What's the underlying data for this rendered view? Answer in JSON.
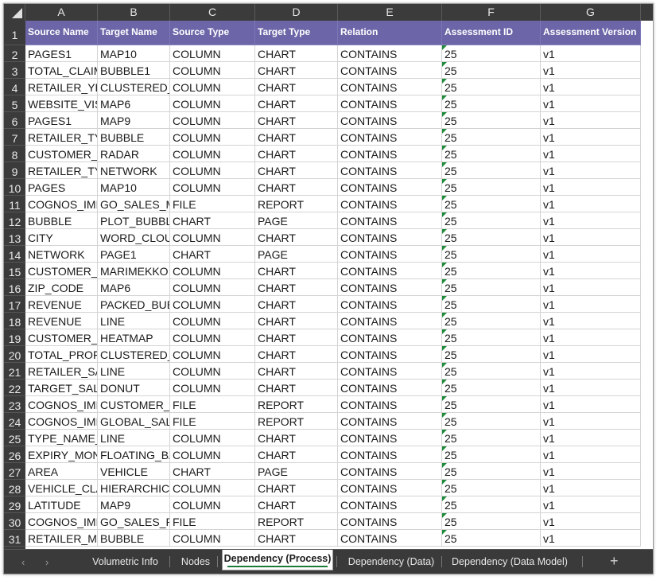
{
  "columns": [
    "A",
    "B",
    "C",
    "D",
    "E",
    "F",
    "G"
  ],
  "header_row": {
    "row_number": "1",
    "cells": [
      "Source Name",
      "Target Name",
      "Source Type",
      "Target Type",
      "Relation",
      "Assessment ID",
      "Assessment Version"
    ]
  },
  "rows": [
    {
      "n": "2",
      "cells": [
        "PAGES1",
        "MAP10",
        "COLUMN",
        "CHART",
        "CONTAINS",
        "25",
        "v1"
      ]
    },
    {
      "n": "3",
      "cells": [
        "TOTAL_CLAIM_",
        "BUBBLE1",
        "COLUMN",
        "CHART",
        "CONTAINS",
        "25",
        "v1"
      ]
    },
    {
      "n": "4",
      "cells": [
        "RETAILER_YEA",
        "CLUSTERED_C",
        "COLUMN",
        "CHART",
        "CONTAINS",
        "25",
        "v1"
      ]
    },
    {
      "n": "5",
      "cells": [
        "WEBSITE_VISI",
        "MAP6",
        "COLUMN",
        "CHART",
        "CONTAINS",
        "25",
        "v1"
      ]
    },
    {
      "n": "6",
      "cells": [
        "PAGES1",
        "MAP9",
        "COLUMN",
        "CHART",
        "CONTAINS",
        "25",
        "v1"
      ]
    },
    {
      "n": "7",
      "cells": [
        "RETAILER_TYPI",
        "BUBBLE",
        "COLUMN",
        "CHART",
        "CONTAINS",
        "25",
        "v1"
      ]
    },
    {
      "n": "8",
      "cells": [
        "CUSTOMER_LI",
        "RADAR",
        "COLUMN",
        "CHART",
        "CONTAINS",
        "25",
        "v1"
      ]
    },
    {
      "n": "9",
      "cells": [
        "RETAILER_TYPI",
        "NETWORK",
        "COLUMN",
        "CHART",
        "CONTAINS",
        "25",
        "v1"
      ]
    },
    {
      "n": "10",
      "cells": [
        "PAGES",
        "MAP10",
        "COLUMN",
        "CHART",
        "CONTAINS",
        "25",
        "v1"
      ]
    },
    {
      "n": "11",
      "cells": [
        "COGNOS_IMP.",
        "GO_SALES_MA",
        "FILE",
        "REPORT",
        "CONTAINS",
        "25",
        "v1"
      ]
    },
    {
      "n": "12",
      "cells": [
        "BUBBLE",
        "PLOT_BUBBLE",
        "CHART",
        "PAGE",
        "CONTAINS",
        "25",
        "v1"
      ]
    },
    {
      "n": "13",
      "cells": [
        "CITY",
        "WORD_CLOUI",
        "COLUMN",
        "CHART",
        "CONTAINS",
        "25",
        "v1"
      ]
    },
    {
      "n": "14",
      "cells": [
        "NETWORK",
        "PAGE1",
        "CHART",
        "PAGE",
        "CONTAINS",
        "25",
        "v1"
      ]
    },
    {
      "n": "15",
      "cells": [
        "CUSTOMER_LI",
        "MARIMEKKO",
        "COLUMN",
        "CHART",
        "CONTAINS",
        "25",
        "v1"
      ]
    },
    {
      "n": "16",
      "cells": [
        "ZIP_CODE",
        "MAP6",
        "COLUMN",
        "CHART",
        "CONTAINS",
        "25",
        "v1"
      ]
    },
    {
      "n": "17",
      "cells": [
        "REVENUE",
        "PACKED_BUBI",
        "COLUMN",
        "CHART",
        "CONTAINS",
        "25",
        "v1"
      ]
    },
    {
      "n": "18",
      "cells": [
        "REVENUE",
        "LINE",
        "COLUMN",
        "CHART",
        "CONTAINS",
        "25",
        "v1"
      ]
    },
    {
      "n": "19",
      "cells": [
        "CUSTOMER_LI",
        "HEATMAP",
        "COLUMN",
        "CHART",
        "CONTAINS",
        "25",
        "v1"
      ]
    },
    {
      "n": "20",
      "cells": [
        "TOTAL_PROFIT",
        "CLUSTERED_E",
        "COLUMN",
        "CHART",
        "CONTAINS",
        "25",
        "v1"
      ]
    },
    {
      "n": "21",
      "cells": [
        "RETAILER_SAL",
        "LINE",
        "COLUMN",
        "CHART",
        "CONTAINS",
        "25",
        "v1"
      ]
    },
    {
      "n": "22",
      "cells": [
        "TARGET_SALES",
        "DONUT",
        "COLUMN",
        "CHART",
        "CONTAINS",
        "25",
        "v1"
      ]
    },
    {
      "n": "23",
      "cells": [
        "COGNOS_IMP.",
        "CUSTOMER_LI",
        "FILE",
        "REPORT",
        "CONTAINS",
        "25",
        "v1"
      ]
    },
    {
      "n": "24",
      "cells": [
        "COGNOS_IMP.",
        "GLOBAL_SALE",
        "FILE",
        "REPORT",
        "CONTAINS",
        "25",
        "v1"
      ]
    },
    {
      "n": "25",
      "cells": [
        "TYPE_NAME_E",
        "LINE",
        "COLUMN",
        "CHART",
        "CONTAINS",
        "25",
        "v1"
      ]
    },
    {
      "n": "26",
      "cells": [
        "EXPIRY_MONT",
        "FLOATING_BAI",
        "COLUMN",
        "CHART",
        "CONTAINS",
        "25",
        "v1"
      ]
    },
    {
      "n": "27",
      "cells": [
        "AREA",
        "VEHICLE",
        "CHART",
        "PAGE",
        "CONTAINS",
        "25",
        "v1"
      ]
    },
    {
      "n": "28",
      "cells": [
        "VEHICLE_CLA",
        "HIERARCHICA",
        "COLUMN",
        "CHART",
        "CONTAINS",
        "25",
        "v1"
      ]
    },
    {
      "n": "29",
      "cells": [
        "LATITUDE",
        "MAP9",
        "COLUMN",
        "CHART",
        "CONTAINS",
        "25",
        "v1"
      ]
    },
    {
      "n": "30",
      "cells": [
        "COGNOS_IMP.",
        "GO_SALES_PE",
        "FILE",
        "REPORT",
        "CONTAINS",
        "25",
        "v1"
      ]
    },
    {
      "n": "31",
      "cells": [
        "RETAILER_MOI",
        "BUBBLE",
        "COLUMN",
        "CHART",
        "CONTAINS",
        "25",
        "v1"
      ]
    }
  ],
  "tabs": {
    "items": [
      "Volumetric Info",
      "Nodes",
      "Dependency (Process)",
      "Dependency (Data)",
      "Dependency (Data Model)"
    ],
    "active": "Dependency (Process)",
    "add_label": "+"
  },
  "colors": {
    "header_fill": "#6c66a8",
    "chrome_dark": "#3b3b3b",
    "indicator_green": "#1e8a3a"
  }
}
